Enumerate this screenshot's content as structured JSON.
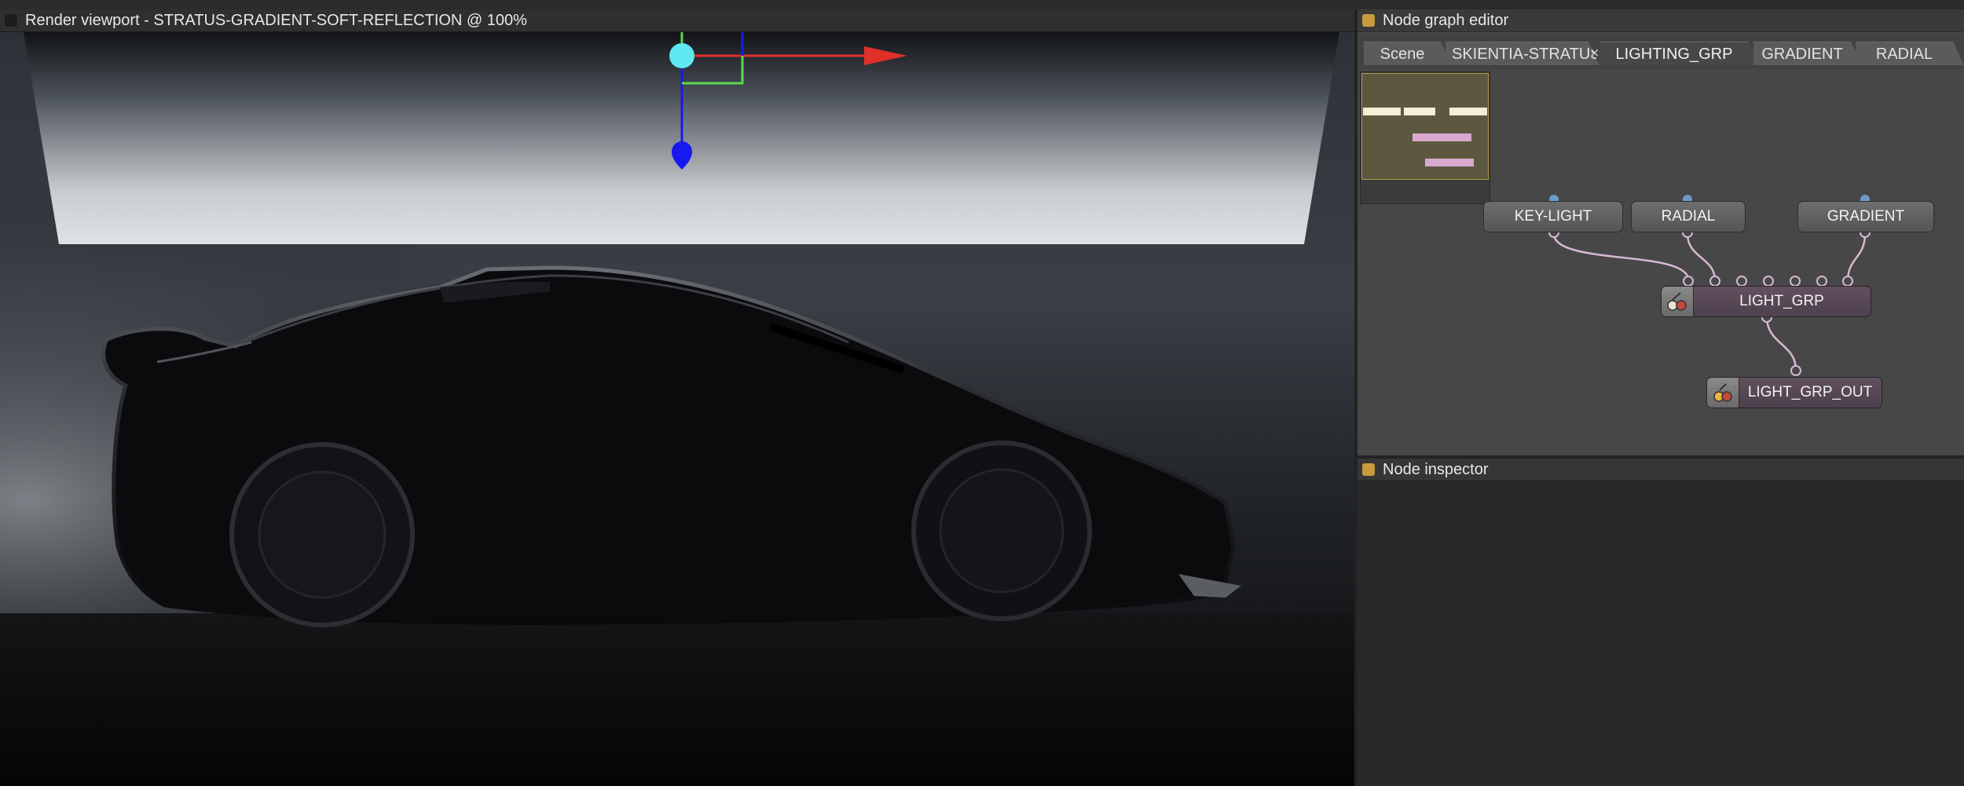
{
  "colors": {
    "panel_marker_dark": "#1d1d1d",
    "panel_marker_gold": "#c89b3c",
    "gizmo_x": "#e0302a",
    "gizmo_y": "#1818f0",
    "gizmo_z": "#5ed850",
    "gizmo_handle": "#5ee8f0",
    "wire": "#d8b8d4",
    "port_in": "#6e9ac8"
  },
  "viewport": {
    "title": "Render viewport - STRATUS-GRADIENT-SOFT-REFLECTION @ 100%"
  },
  "node_graph": {
    "title": "Node graph editor",
    "tabs": [
      {
        "label": "Scene",
        "active": false
      },
      {
        "label": "SKIENTIA-STRATUS",
        "active": false
      },
      {
        "label": "LIGHTING_GRP",
        "active": true
      },
      {
        "label": "GRADIENT",
        "active": false
      },
      {
        "label": "RADIAL",
        "active": false
      }
    ],
    "tab_close_glyph": "×",
    "nodes": [
      {
        "label": "KEY-LIGHT"
      },
      {
        "label": "RADIAL"
      },
      {
        "label": "GRADIENT"
      },
      {
        "label": "LIGHT_GRP",
        "icon": "group-node-icon"
      },
      {
        "label": "LIGHT_GRP_OUT",
        "icon": "output-node-icon"
      }
    ]
  },
  "inspector": {
    "title": "Node inspector"
  }
}
